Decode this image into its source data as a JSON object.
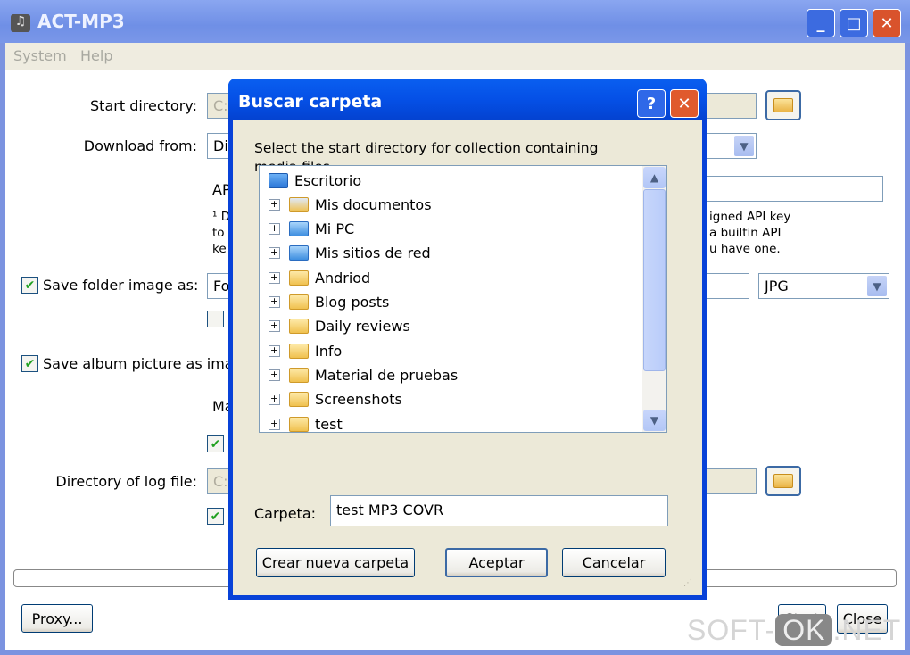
{
  "window": {
    "title": "ACT-MP3",
    "menu": [
      "System",
      "Help"
    ],
    "minimize": "_",
    "maximize": "□",
    "close": "✕"
  },
  "form": {
    "start_dir_label": "Start directory:",
    "start_dir_value": "C:",
    "download_label": "Download from:",
    "download_value": "Dis",
    "api_label": "AP",
    "note_left": [
      "¹ D",
      "to",
      "ke"
    ],
    "note_right": [
      "igned API key",
      "a builtin API",
      "u have one."
    ],
    "save_folder_label": "Save folder image as:",
    "save_folder_checked": true,
    "save_folder_value": "Fo",
    "format_value": "JPG",
    "sub_checkbox_checked": false,
    "save_album_label": "Save album picture as imag",
    "save_album_checked": true,
    "ma_label": "Ma",
    "check3_checked": true,
    "log_dir_label": "Directory of log file:",
    "log_dir_value": "C:",
    "check4_checked": true,
    "proxy_label": "Proxy...",
    "start_label": "Start",
    "close_label": "Close"
  },
  "dialog": {
    "title": "Buscar carpeta",
    "help": "?",
    "close": "✕",
    "instruction": "Select the start directory for collection containing media files.",
    "tree": [
      {
        "label": "Escritorio",
        "icon": "desktop-icon",
        "root": true
      },
      {
        "label": "Mis documentos",
        "icon": "my-documents-icon"
      },
      {
        "label": "Mi PC",
        "icon": "my-computer-icon"
      },
      {
        "label": "Mis sitios de red",
        "icon": "network-icon"
      },
      {
        "label": "Andriod",
        "icon": "folder-icon"
      },
      {
        "label": "Blog posts",
        "icon": "folder-icon"
      },
      {
        "label": "Daily reviews",
        "icon": "folder-icon"
      },
      {
        "label": "Info",
        "icon": "folder-icon"
      },
      {
        "label": "Material de pruebas",
        "icon": "folder-icon"
      },
      {
        "label": "Screenshots",
        "icon": "folder-icon"
      },
      {
        "label": "test",
        "icon": "folder-icon"
      }
    ],
    "folder_label": "Carpeta:",
    "folder_value": "test MP3 COVR",
    "new_folder": "Crear nueva carpeta",
    "ok": "Aceptar",
    "cancel": "Cancelar"
  },
  "watermark": {
    "left": "SOFT-",
    "mid": "OK",
    "right": ".NET"
  }
}
